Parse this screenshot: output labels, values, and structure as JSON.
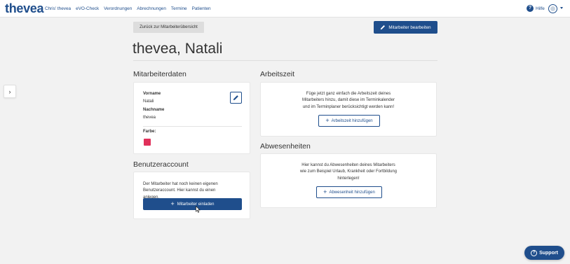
{
  "brand": {
    "logo": "thevea"
  },
  "nav": {
    "items": [
      {
        "label": "Chris' thevea"
      },
      {
        "label": "eVO-Check"
      },
      {
        "label": "Verordnungen"
      },
      {
        "label": "Abrechnungen"
      },
      {
        "label": "Termine"
      },
      {
        "label": "Patienten"
      }
    ],
    "help_label": "Hilfe",
    "help_icon": "question-circle-icon",
    "avatar_icon": "user-avatar-icon"
  },
  "header": {
    "back_label": "Zurück zur Mitarbeiterübersicht",
    "edit_label": "Mitarbeiter bearbeiten",
    "title": "thevea, Natali"
  },
  "mitarbeiterdaten": {
    "heading": "Mitarbeiterdaten",
    "vorname_label": "Vorname",
    "vorname_value": "Natali",
    "nachname_label": "Nachname",
    "nachname_value": "thevea",
    "farbe_label": "Farbe:",
    "farbe_color": "#e0305a"
  },
  "benutzeraccount": {
    "heading": "Benutzeraccount",
    "text_line1": "Der Mitarbeiter hat noch keinen eigenen",
    "text_line2": "Benutzeraccount. Hier kannst du einen anlegen.",
    "invite_label": "Mitarbeiter einladen"
  },
  "arbeitszeit": {
    "heading": "Arbeitszeit",
    "text_line1": "Füge jetzt ganz einfach die Arbeitszeit deines",
    "text_line2": "Mitarbeiters hinzu, damit diese im Terminkalender",
    "text_line3": "und im Terminplaner berücksichtigt werden kann!",
    "add_label": "Arbeitszeit hinzufügen"
  },
  "abwesenheiten": {
    "heading": "Abwesenheiten",
    "text_line1": "Hier kannst du Abwesenheiten deines Mitarbeiters",
    "text_line2": "wie zum Beispiel Urlaub, Krankheit oder Fortbildung",
    "text_line3": "hinterlegen!",
    "add_label": "Abwesenheit hinzufügen"
  },
  "support": {
    "label": "Support"
  },
  "colors": {
    "accent": "#1f4e8c",
    "background": "#f2f2f2"
  }
}
